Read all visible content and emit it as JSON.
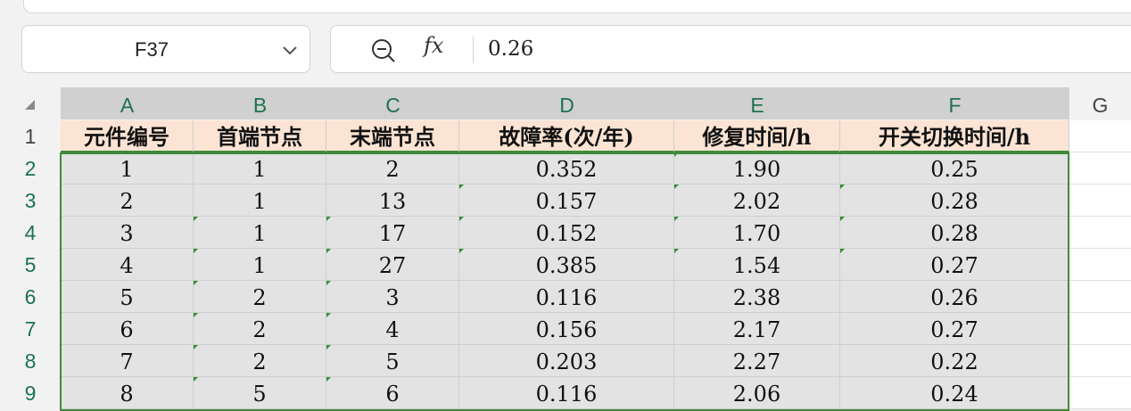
{
  "name_box": {
    "ref": "F37"
  },
  "formula_bar": {
    "fx_label": "fx",
    "value": "0.26"
  },
  "columns": [
    "A",
    "B",
    "C",
    "D",
    "E",
    "F",
    "G"
  ],
  "rows": [
    "1",
    "2",
    "3",
    "4",
    "5",
    "6",
    "7",
    "8",
    "9"
  ],
  "headers": [
    "元件编号",
    "首端节点",
    "末端节点",
    "故障率(次/年)",
    "修复时间/h",
    "开关切换时间/h"
  ],
  "data": [
    [
      "1",
      "1",
      "2",
      "0.352",
      "1.90",
      "0.25"
    ],
    [
      "2",
      "1",
      "13",
      "0.157",
      "2.02",
      "0.28"
    ],
    [
      "3",
      "1",
      "17",
      "0.152",
      "1.70",
      "0.28"
    ],
    [
      "4",
      "1",
      "27",
      "0.385",
      "1.54",
      "0.27"
    ],
    [
      "5",
      "2",
      "3",
      "0.116",
      "2.38",
      "0.26"
    ],
    [
      "6",
      "2",
      "4",
      "0.156",
      "2.17",
      "0.27"
    ],
    [
      "7",
      "2",
      "5",
      "0.203",
      "2.27",
      "0.22"
    ],
    [
      "8",
      "5",
      "6",
      "0.116",
      "2.06",
      "0.24"
    ]
  ],
  "colors": {
    "selection": "#3f8a3a",
    "header_fill": "#fbe4d3",
    "header_text": "#1e7250"
  }
}
